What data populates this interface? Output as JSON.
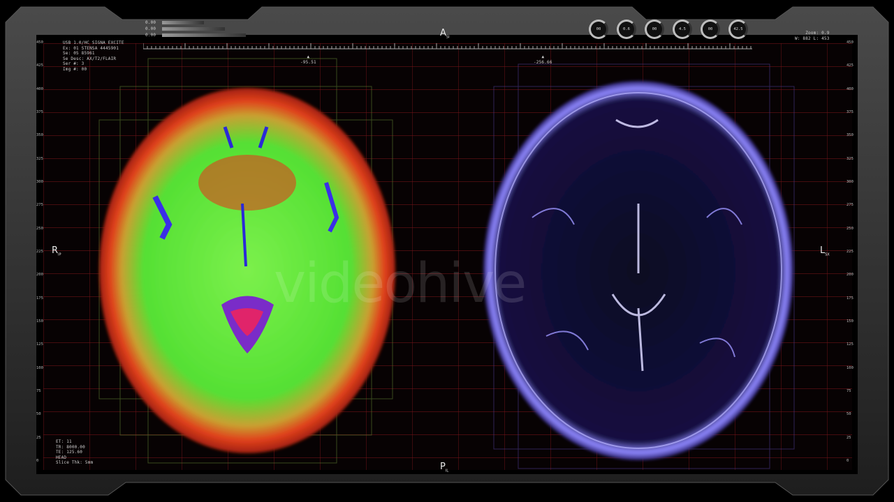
{
  "watermark": "videohive",
  "orientation": {
    "top": "A",
    "top_sub": "SI",
    "bottom": "P",
    "bottom_sub": "IL",
    "left": "R",
    "left_sub": "IP",
    "right": "L",
    "right_sub": "SX"
  },
  "top_left_info": [
    "USB 1.0/HC SIGNA EXCITE",
    "Ex: 01 STENSA 4445901",
    "Se: 05 85961",
    "Se Desc: AX/T2/FLAIR",
    "Ser #: 3",
    "Img #: 00"
  ],
  "top_right_info": [
    "Zoom: 0.9",
    "W: 882  L: 453"
  ],
  "bottom_left_info": [
    "ET: 11",
    "TR: 8000.00",
    "TE: 125.60",
    "HEAD",
    "Slice Thk: 5mm"
  ],
  "markers": [
    "-95.51",
    "-256.66"
  ],
  "header_bars": [
    "0.00",
    "0.00",
    "0.00"
  ],
  "dials": [
    "00",
    "0.6",
    "00",
    "4.5",
    "00",
    "42.5"
  ],
  "scale_left": [
    "450",
    "425",
    "400",
    "375",
    "350",
    "325",
    "300",
    "275",
    "250",
    "225",
    "200",
    "175",
    "150",
    "125",
    "100",
    "75",
    "50",
    "25",
    "0"
  ],
  "scale_right": [
    "450",
    "425",
    "400",
    "375",
    "350",
    "325",
    "300",
    "275",
    "250",
    "225",
    "200",
    "175",
    "150",
    "125",
    "100",
    "75",
    "50",
    "25",
    "0"
  ],
  "colors": {
    "grid": "#781419",
    "frame": "#3a3a3a",
    "scan_left_outer": "#e0401c",
    "scan_left_inner": "#5ee83a",
    "scan_right": "#6a60ff"
  }
}
